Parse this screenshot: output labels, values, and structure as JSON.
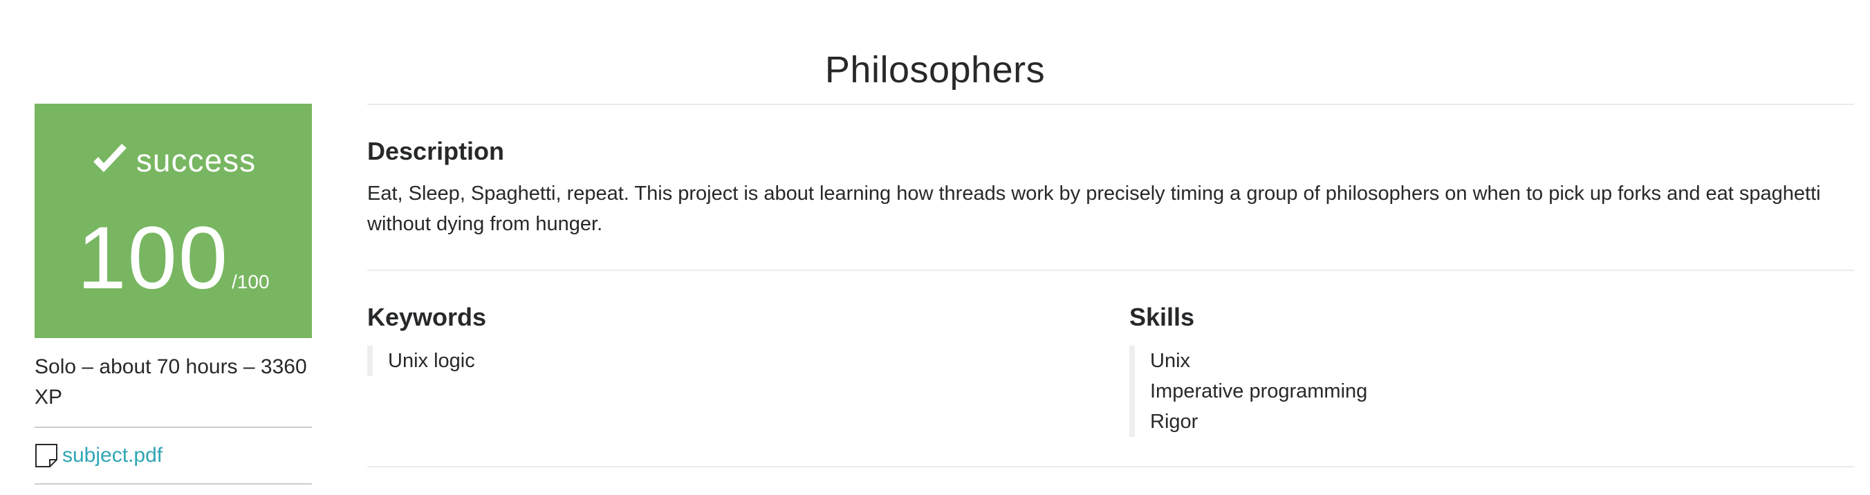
{
  "title": "Philosophers",
  "grade": {
    "status": "success",
    "score": "100",
    "max": "/100",
    "icon": "check-icon",
    "color": "#78b661"
  },
  "meta": "Solo – about 70 hours – 3360 XP",
  "attachment": {
    "icon": "file-icon",
    "label": "subject.pdf",
    "color": "#2fa6b4"
  },
  "description": {
    "heading": "Description",
    "text": "Eat, Sleep, Spaghetti, repeat. This project is about learning how threads work by precisely timing a group of philosophers on when to pick up forks and eat spaghetti without dying from hunger."
  },
  "keywords": {
    "heading": "Keywords",
    "items": [
      "Unix logic"
    ]
  },
  "skills": {
    "heading": "Skills",
    "items": [
      "Unix",
      "Imperative programming",
      "Rigor"
    ]
  }
}
